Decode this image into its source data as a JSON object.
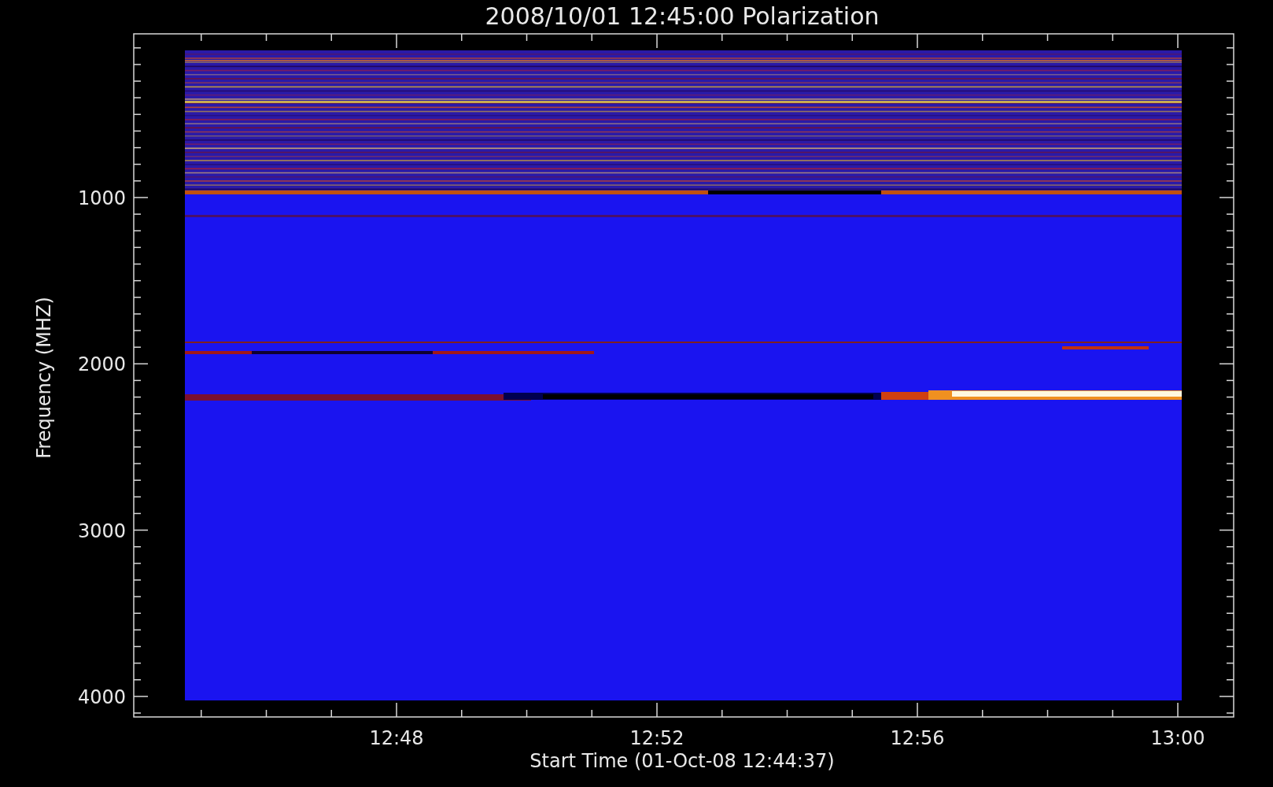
{
  "title": "2008/10/01  12:45:00  Polarization",
  "y_axis": {
    "label": "Frequency (MHZ)",
    "ticks": [
      "1000",
      "2000",
      "3000",
      "4000"
    ]
  },
  "x_axis": {
    "label": "Start Time (01-Oct-08 12:44:37)",
    "ticks": [
      "12:48",
      "12:52",
      "12:56",
      "13:00"
    ]
  }
}
